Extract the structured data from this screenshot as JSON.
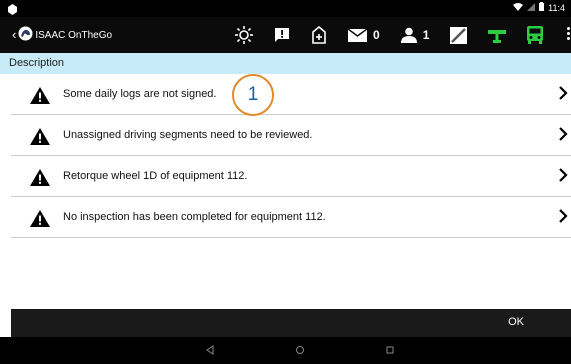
{
  "app": {
    "title": "ISAAC OnTheGo"
  },
  "status_bar": {
    "time": "11:4"
  },
  "toolbar": {
    "messages_count": "0",
    "users_count": "1"
  },
  "list": {
    "header": "Description",
    "items": [
      {
        "text": "Some daily logs are not signed."
      },
      {
        "text": "Unassigned driving segments need to be reviewed."
      },
      {
        "text": "Retorque wheel 1D of equipment 112."
      },
      {
        "text": "No inspection has been completed for equipment 112."
      }
    ]
  },
  "callout": {
    "label": "1"
  },
  "footer": {
    "ok_label": "OK"
  },
  "colors": {
    "accent_green": "#2ecc40",
    "header_blue": "#c7ebf8",
    "callout_orange": "#e58a2a"
  }
}
